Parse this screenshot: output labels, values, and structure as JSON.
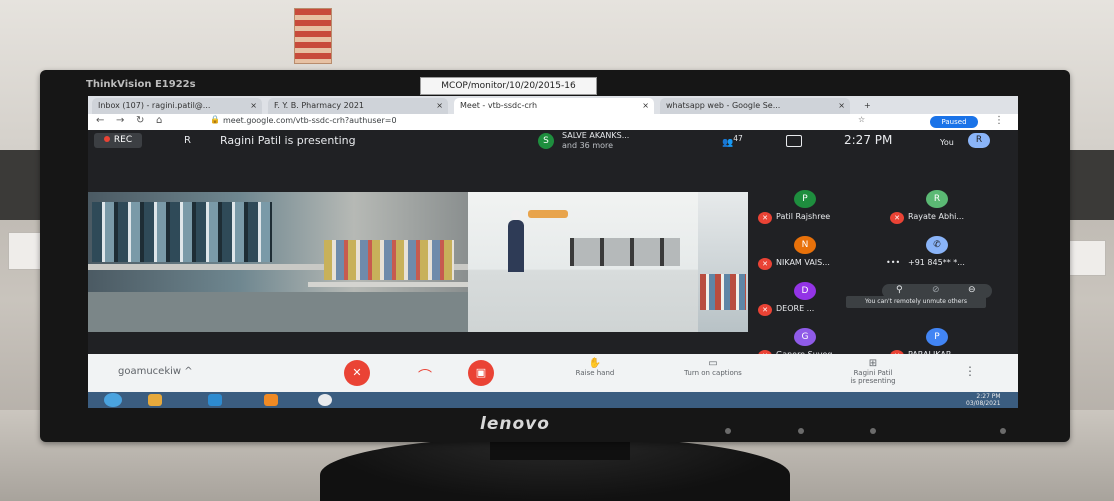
{
  "monitor": {
    "model_label": "ThinkVision E1922s",
    "sticker": "MCOP/monitor/10/20/2015-16",
    "brand": "lenovo"
  },
  "browser": {
    "tabs": [
      {
        "label": "Inbox (107) - ragini.patil@...",
        "close": "×"
      },
      {
        "label": "F. Y. B. Pharmacy 2021",
        "close": "×"
      },
      {
        "label": "Meet - vtb-ssdc-crh",
        "close": "×"
      },
      {
        "label": "whatsapp web - Google Se...",
        "close": "×"
      }
    ],
    "new_tab": "+",
    "url": "meet.google.com/vtb-ssdc-crh?authuser=0",
    "paused": "Paused"
  },
  "meet": {
    "rec": "REC",
    "presenter_initial": "R",
    "presenting_text": "Ragini Patil is presenting",
    "salve_initial": "S",
    "salve_name": "SALVE AKANKS...",
    "salve_more": "and 36 more",
    "people_count": "47",
    "clock": "2:27 PM",
    "you_label": "You",
    "you_initial": "R",
    "tooltip": "You can't remotely unmute others",
    "participants": [
      {
        "initial": "P",
        "name": "Patil Rajshree",
        "color": "#1e8e3e"
      },
      {
        "initial": "R",
        "name": "Rayate Abhi...",
        "color": "#5bb974"
      },
      {
        "initial": "N",
        "name": "NIKAM VAIS...",
        "color": "#e8710a"
      },
      {
        "phone": "✆",
        "name": "+91 845** *...",
        "color": "#8ab4f8"
      },
      {
        "initial": "D",
        "name": "DEORE ...",
        "color": "#9334e6"
      },
      {
        "initial": "G",
        "name": "Ganore Suyog",
        "color": "#8f5be8"
      },
      {
        "initial": "P",
        "name": "PARALIKAR ...",
        "color": "#4285f4"
      }
    ],
    "dots": "•••",
    "controls": {
      "meeting_code": "goamucekiw",
      "raise_hand": "Raise hand",
      "captions": "Turn on captions",
      "presenting_line1": "Ragini Patil",
      "presenting_line2": "is presenting"
    }
  },
  "taskbar": {
    "time": "2:27 PM",
    "date": "03/08/2021"
  }
}
